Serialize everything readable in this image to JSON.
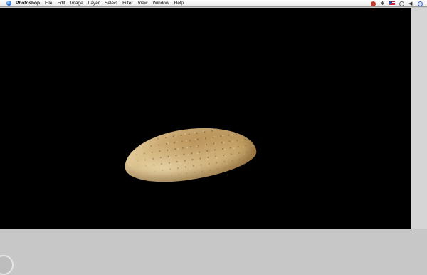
{
  "menubar": {
    "app_name": "Photoshop",
    "items": [
      "File",
      "Edit",
      "Image",
      "Layer",
      "Select",
      "Filter",
      "View",
      "Window",
      "Help"
    ]
  },
  "status_icons": [
    "bug-icon",
    "bluetooth-icon",
    "us-flag-icon",
    "clock-icon",
    "volume-icon",
    "spotlight-icon"
  ],
  "canvas": {
    "background": "#000000",
    "subject": "bread-loaf"
  }
}
